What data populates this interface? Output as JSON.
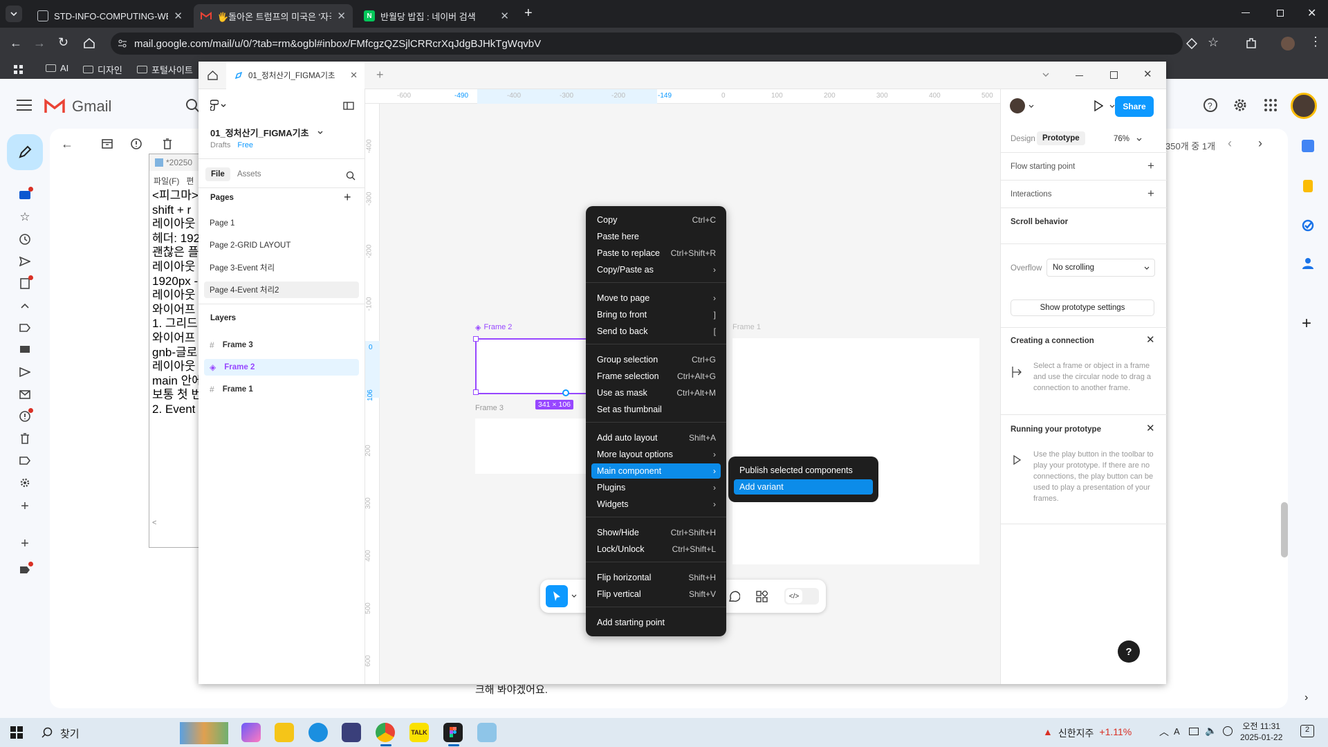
{
  "browser": {
    "tabs": [
      {
        "title": "STD-INFO-COMPUTING-WEB-",
        "favicon": "document-icon"
      },
      {
        "title": "🖐️돌아온 트럼프의 미국은 '자국",
        "favicon": "gmail-icon"
      },
      {
        "title": "반월당 밥집 : 네이버 검색",
        "favicon": "naver-icon",
        "favicon_letter": "N"
      }
    ],
    "url": "mail.google.com/mail/u/0/?tab=rm&ogbl#inbox/FMfcgzQZSjlCRRcrXqJdgBJHkTgWqvbV",
    "bookmarks": [
      "AI",
      "디자인",
      "포털사이트"
    ],
    "window_controls": [
      "minimize",
      "restore",
      "close"
    ]
  },
  "gmail": {
    "app_name": "Gmail",
    "pagination": "350개 중 1개",
    "body_text_bottom": "크해 봐야겠어요.",
    "nav_icons": [
      "inbox-icon",
      "star-icon",
      "clock-icon",
      "send-icon",
      "draft-icon",
      "chevron-up-icon",
      "label-icon",
      "chat-icon",
      "scheduled-icon",
      "mail-icon",
      "spam-icon",
      "trash-icon",
      "label-icon",
      "gear-icon",
      "plus-icon"
    ]
  },
  "notepad": {
    "title": "*20250",
    "menu": [
      "파일(F)",
      "편"
    ],
    "lines": [
      "<피그마>",
      "shift + r",
      "레이아웃",
      "헤더: 192",
      "괜찮은 플",
      "",
      "레이아웃",
      "1920px -",
      "레이아웃",
      "",
      "와이어프",
      "1. 그리드",
      "와이어프",
      "gnb-글로",
      "레이아웃",
      "main 안에",
      "보통 첫 번",
      "",
      "2. Event"
    ]
  },
  "figma": {
    "window": {
      "tab_title": "01_정처산기_FIGMA기초",
      "add_tab": "+"
    },
    "file": {
      "name": "01_정처산기_FIGMA기초",
      "location": "Drafts",
      "plan": "Free"
    },
    "left_tabs": [
      "File",
      "Assets"
    ],
    "pages_label": "Pages",
    "pages": [
      "Page 1",
      "Page 2-GRID LAYOUT",
      "Page 3-Event 처리",
      "Page 4-Event 처리2"
    ],
    "active_page": 3,
    "layers_label": "Layers",
    "layers": [
      "Frame 3",
      "Frame 2",
      "Frame 1"
    ],
    "selected_layer": 1,
    "ruler": {
      "h": [
        "-600",
        "-490",
        "-400",
        "-300",
        "-200",
        "-149",
        "0",
        "100",
        "200",
        "300",
        "400",
        "500"
      ],
      "v": [
        "-400",
        "-300",
        "-200",
        "-100",
        "0",
        "106",
        "200",
        "300",
        "400",
        "500",
        "600"
      ]
    },
    "canvas": {
      "frame2_label": "Frame 2",
      "frame3_label": "Frame 3",
      "frame1_label": "Frame 1",
      "size_badge": "341 × 106"
    },
    "toolbar_icons": [
      "move-icon",
      "frame-icon",
      "rectangle-icon",
      "pen-icon",
      "text-icon",
      "comment-icon",
      "components-icon",
      "dev-mode-icon"
    ],
    "right_panel": {
      "share_label": "Share",
      "tabs": [
        "Design",
        "Prototype"
      ],
      "active_tab": "Prototype",
      "zoom": "76%",
      "flow_starting_point": "Flow starting point",
      "interactions": "Interactions",
      "scroll_behavior": "Scroll behavior",
      "overflow_label": "Overflow",
      "overflow_value": "No scrolling",
      "show_settings": "Show prototype settings",
      "creating_connection_title": "Creating a connection",
      "creating_connection_text": "Select a frame or object in a frame and use the circular node to drag a connection to another frame.",
      "running_title": "Running your prototype",
      "running_text": "Use the play button in the toolbar to play your prototype. If there are no connections, the play button can be used to play a presentation of your frames.",
      "help": "?"
    },
    "context_menu": {
      "groups": [
        [
          {
            "label": "Copy",
            "shortcut": "Ctrl+C"
          },
          {
            "label": "Paste here",
            "shortcut": ""
          },
          {
            "label": "Paste to replace",
            "shortcut": "Ctrl+Shift+R"
          },
          {
            "label": "Copy/Paste as",
            "shortcut": "›"
          }
        ],
        [
          {
            "label": "Move to page",
            "shortcut": "›"
          },
          {
            "label": "Bring to front",
            "shortcut": "]"
          },
          {
            "label": "Send to back",
            "shortcut": "["
          }
        ],
        [
          {
            "label": "Group selection",
            "shortcut": "Ctrl+G"
          },
          {
            "label": "Frame selection",
            "shortcut": "Ctrl+Alt+G"
          },
          {
            "label": "Use as mask",
            "shortcut": "Ctrl+Alt+M"
          },
          {
            "label": "Set as thumbnail",
            "shortcut": ""
          }
        ],
        [
          {
            "label": "Add auto layout",
            "shortcut": "Shift+A"
          },
          {
            "label": "More layout options",
            "shortcut": "›"
          },
          {
            "label": "Main component",
            "shortcut": "›"
          },
          {
            "label": "Plugins",
            "shortcut": "›"
          },
          {
            "label": "Widgets",
            "shortcut": "›"
          }
        ],
        [
          {
            "label": "Show/Hide",
            "shortcut": "Ctrl+Shift+H"
          },
          {
            "label": "Lock/Unlock",
            "shortcut": "Ctrl+Shift+L"
          }
        ],
        [
          {
            "label": "Flip horizontal",
            "shortcut": "Shift+H"
          },
          {
            "label": "Flip vertical",
            "shortcut": "Shift+V"
          }
        ],
        [
          {
            "label": "Add starting point",
            "shortcut": ""
          }
        ]
      ],
      "highlighted": "Main component",
      "submenu": [
        "Publish selected components",
        "Add variant"
      ],
      "submenu_highlighted": "Add variant"
    }
  },
  "taskbar": {
    "search_placeholder": "찾기",
    "stock_name": "신한지주",
    "stock_change": "+1.11%",
    "time": "오전 11:31",
    "date": "2025-01-22",
    "notification_count": "2",
    "ime": "A"
  },
  "colors": {
    "figma_blue": "#0d99ff",
    "component_purple": "#9747ff",
    "menu_highlight": "#0c8ce9",
    "gmail_red": "#ea4335"
  }
}
